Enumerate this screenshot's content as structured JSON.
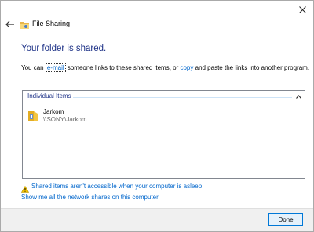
{
  "window": {
    "title": "File Sharing",
    "icons": {
      "back": "back-arrow-icon",
      "app": "file-sharing-icon",
      "close": "close-icon"
    }
  },
  "main": {
    "heading": "Your folder is shared.",
    "description": {
      "prefix": "You can ",
      "email_link": "e-mail",
      "middle": " someone links to these shared items, or ",
      "copy_link": "copy",
      "suffix": " and paste the links into another program."
    }
  },
  "items_panel": {
    "group_label": "Individual Items",
    "collapse_icon": "chevron-up-icon",
    "items": [
      {
        "name": "Jarkom",
        "path": "\\\\SONY\\Jarkom",
        "icon": "folder-icon"
      }
    ]
  },
  "links": {
    "warning": "Shared items aren't accessible when your computer is asleep.",
    "warning_icon": "warning-icon",
    "network_shares": "Show me all the network shares on this computer."
  },
  "footer": {
    "done_label": "Done"
  },
  "colors": {
    "heading": "#1e3287",
    "link": "#0066cc",
    "footer_bg": "#f0f0f0",
    "button_border": "#0078d7"
  }
}
